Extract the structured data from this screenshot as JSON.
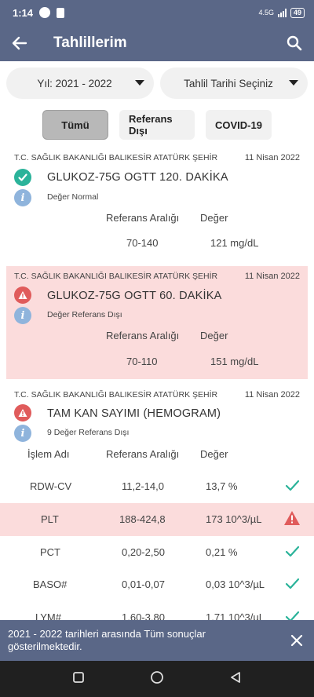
{
  "status_bar": {
    "time": "1:14",
    "network": "4.5G",
    "battery": "49"
  },
  "app_bar": {
    "title": "Tahlillerim"
  },
  "filters": {
    "year": "Yıl: 2021 - 2022",
    "date": "Tahlil Tarihi Seçiniz"
  },
  "tabs": [
    "Tümü",
    "Referans Dışı",
    "COVID-19"
  ],
  "columns": {
    "process": "İşlem Adı",
    "reference": "Referans Aralığı",
    "value": "Değer"
  },
  "results": [
    {
      "hospital": "T.C. SAĞLIK BAKANLIĞI BALIKESİR ATATÜRK ŞEHİR",
      "date": "11 Nisan 2022",
      "name": "GLUKOZ-75G OGTT 120. DAKİKA",
      "note": "Değer Normal",
      "reference": "70-140",
      "value": "121 mg/dL",
      "status": "normal"
    },
    {
      "hospital": "T.C. SAĞLIK BAKANLIĞI BALIKESİR ATATÜRK ŞEHİR",
      "date": "11 Nisan 2022",
      "name": "GLUKOZ-75G OGTT 60. DAKİKA",
      "note": "Değer Referans Dışı",
      "reference": "70-110",
      "value": "151 mg/dL",
      "status": "abnormal"
    },
    {
      "hospital": "T.C. SAĞLIK BAKANLIĞI BALIKESİR ATATÜRK ŞEHİR",
      "date": "11 Nisan 2022",
      "name": "TAM KAN SAYIMI (HEMOGRAM)",
      "note": "9 Değer Referans Dışı",
      "status": "abnormal"
    }
  ],
  "hemogram_rows": [
    {
      "name": "RDW-CV",
      "reference": "11,2-14,0",
      "value": "13,7 %",
      "status": "normal"
    },
    {
      "name": "PLT",
      "reference": "188-424,8",
      "value": "173 10^3/µL",
      "status": "abnormal"
    },
    {
      "name": "PCT",
      "reference": "0,20-2,50",
      "value": "0,21 %",
      "status": "normal"
    },
    {
      "name": "BASO#",
      "reference": "0,01-0,07",
      "value": "0,03 10^3/µL",
      "status": "normal"
    },
    {
      "name": "LYM#",
      "reference": "1,60-3,80",
      "value": "1,71 10^3/µL",
      "status": "normal"
    }
  ],
  "snackbar": {
    "message": "2021 - 2022 tarihleri arasında Tüm sonuçlar gösterilmektedir."
  },
  "colors": {
    "primary": "#5a6787",
    "ok": "#2bb39a",
    "alert_bg": "#fbdcdc",
    "warn": "#e05b5b",
    "info": "#8fb4dc"
  }
}
